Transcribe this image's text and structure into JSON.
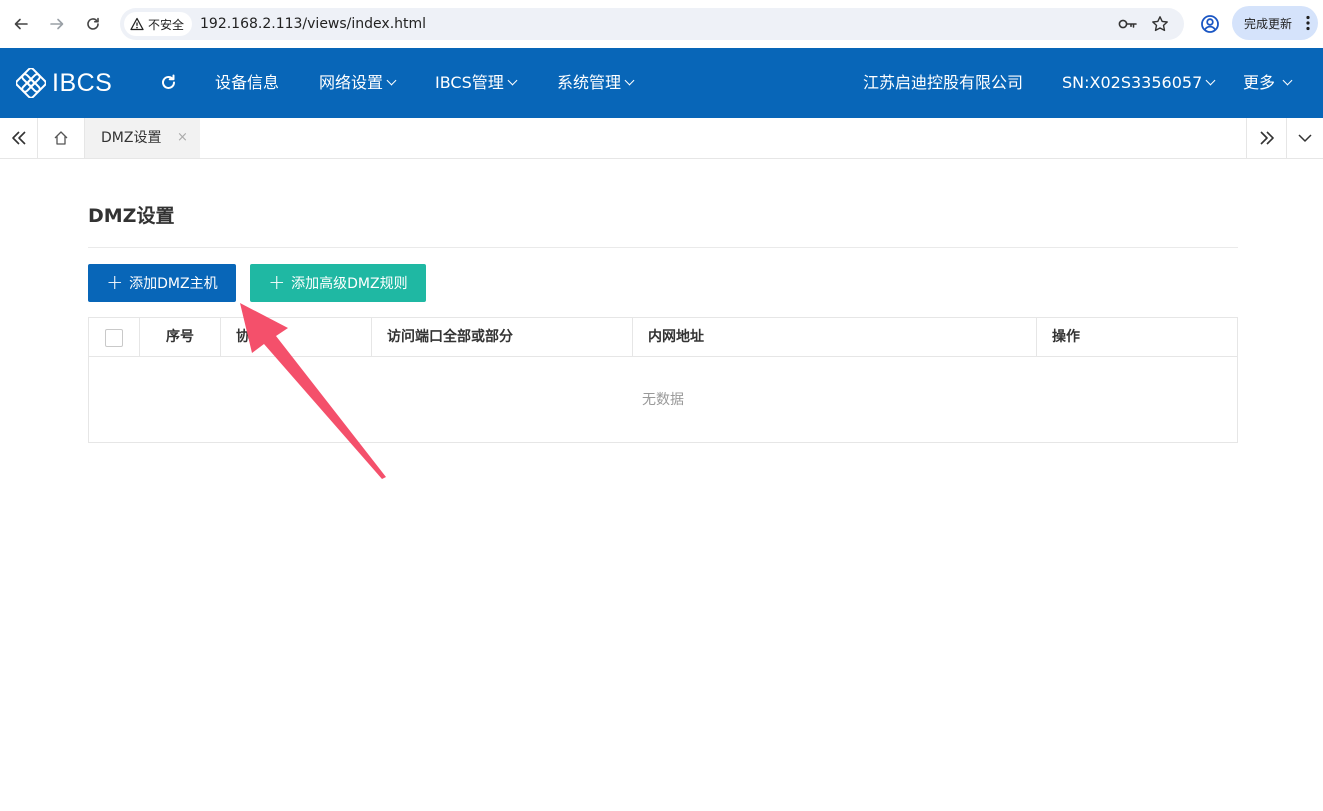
{
  "browser": {
    "security_label": "不安全",
    "url": "192.168.2.113/views/index.html",
    "update_label": "完成更新"
  },
  "header": {
    "logo_text": "IBCS",
    "menu": [
      {
        "label": "设备信息"
      },
      {
        "label": "网络设置"
      },
      {
        "label": "IBCS管理"
      },
      {
        "label": "系统管理"
      }
    ],
    "company": "江苏启迪控股有限公司",
    "serial": "SN:X02S3356057",
    "more_label": "更多"
  },
  "tabs": {
    "active_tab": "DMZ设置",
    "close_glyph": "×"
  },
  "page": {
    "title": "DMZ设置",
    "add_host_button": "添加DMZ主机",
    "add_rule_button": "添加高级DMZ规则",
    "table": {
      "columns": [
        "序号",
        "协",
        "访问端口全部或部分",
        "内网地址",
        "操作"
      ],
      "empty_text": "无数据"
    }
  },
  "colors": {
    "brand_blue": "#0866b8",
    "teal": "#1fb8a3",
    "annotation_arrow": "#f4506b"
  }
}
